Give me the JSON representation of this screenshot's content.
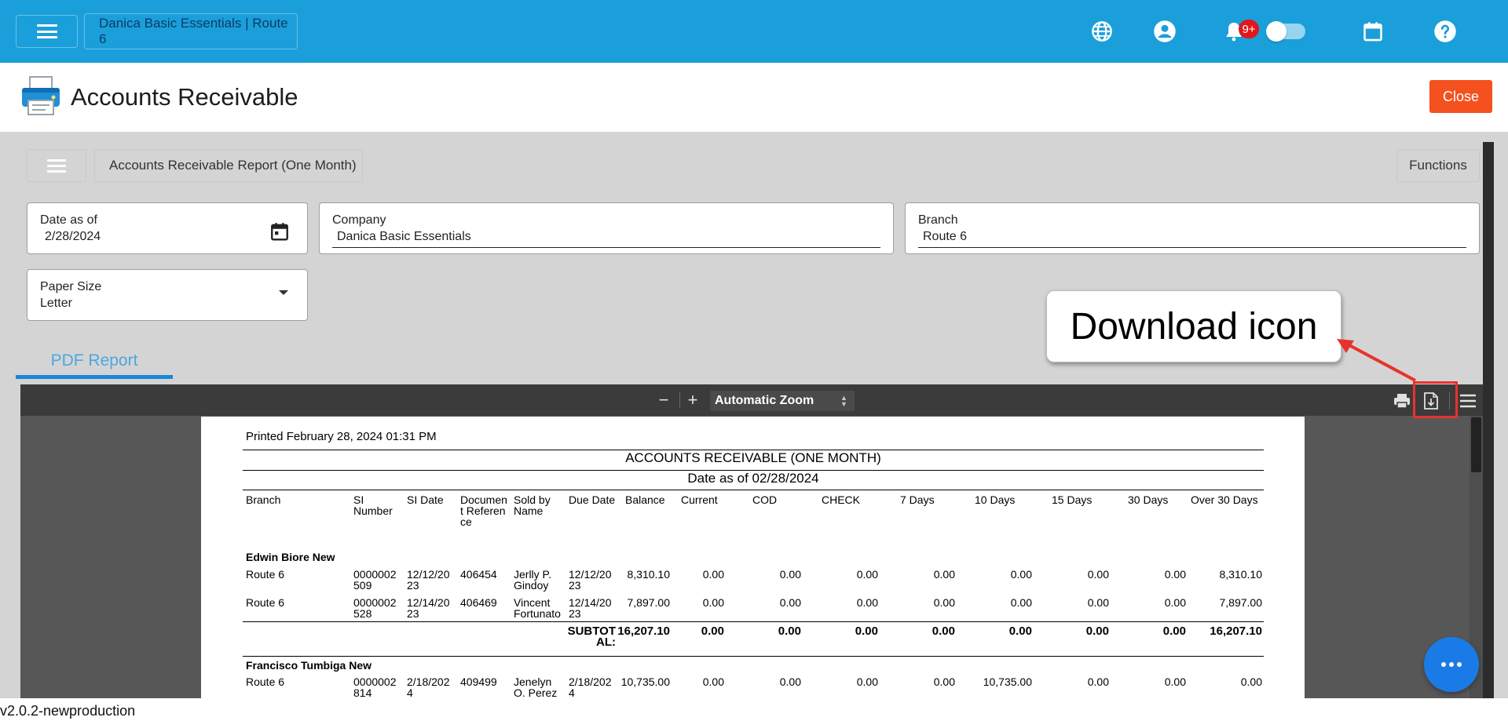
{
  "topbar": {
    "title": "Danica Basic Essentials | Route 6",
    "notification_badge": "9+",
    "accent_color": "#1a9fdb"
  },
  "header": {
    "title": "Accounts Receivable",
    "close_label": "Close"
  },
  "subbar": {
    "report_title": "Accounts Receivable Report (One Month)",
    "functions_label": "Functions"
  },
  "filters": {
    "date_label": "Date as of",
    "date_value": "2/28/2024",
    "company_label": "Company",
    "company_value": "Danica Basic Essentials",
    "branch_label": "Branch",
    "branch_value": "Route 6",
    "paper_label": "Paper Size",
    "paper_value": "Letter"
  },
  "tabs": {
    "pdf_label": "PDF Report"
  },
  "viewer": {
    "zoom_minus": "−",
    "zoom_plus": "+",
    "zoom_value": "Automatic Zoom"
  },
  "report": {
    "printed": "Printed February 28, 2024 01:31 PM",
    "title": "ACCOUNTS RECEIVABLE (ONE MONTH)",
    "date_as_of": "Date as of 02/28/2024",
    "columns": [
      "Branch",
      "SI Number",
      "SI Date",
      "Document Reference",
      "Sold by Name",
      "Due Date",
      "Balance",
      "Current",
      "COD",
      "CHECK",
      "7 Days",
      "10 Days",
      "15 Days",
      "30 Days",
      "Over 30 Days"
    ],
    "groups": [
      {
        "name": "Edwin Biore New",
        "rows": [
          {
            "branch": "Route 6",
            "si_number": "0000002509",
            "si_date": "12/12/2023",
            "doc_ref": "406454",
            "sold_by": "Jerlly P. Gindoy",
            "due_date": "12/12/2023",
            "balance": "8,310.10",
            "current": "0.00",
            "cod": "0.00",
            "check": "0.00",
            "d7": "0.00",
            "d10": "0.00",
            "d15": "0.00",
            "d30": "0.00",
            "over30": "8,310.10"
          },
          {
            "branch": "Route 6",
            "si_number": "0000002528",
            "si_date": "12/14/2023",
            "doc_ref": "406469",
            "sold_by": "Vincent Fortunato",
            "due_date": "12/14/2023",
            "balance": "7,897.00",
            "current": "0.00",
            "cod": "0.00",
            "check": "0.00",
            "d7": "0.00",
            "d10": "0.00",
            "d15": "0.00",
            "d30": "0.00",
            "over30": "7,897.00"
          }
        ],
        "subtotal": {
          "label": "SUBTOTAL:",
          "balance": "16,207.10",
          "current": "0.00",
          "cod": "0.00",
          "check": "0.00",
          "d7": "0.00",
          "d10": "0.00",
          "d15": "0.00",
          "d30": "0.00",
          "over30": "16,207.10"
        }
      },
      {
        "name": "Francisco Tumbiga New",
        "rows": [
          {
            "branch": "Route 6",
            "si_number": "0000002814",
            "si_date": "2/18/2024",
            "doc_ref": "409499",
            "sold_by": "Jenelyn O. Perez",
            "due_date": "2/18/2024",
            "balance": "10,735.00",
            "current": "0.00",
            "cod": "0.00",
            "check": "0.00",
            "d7": "0.00",
            "d10": "10,735.00",
            "d15": "0.00",
            "d30": "0.00",
            "over30": "0.00"
          }
        ]
      }
    ]
  },
  "annotation": {
    "callout_text": "Download icon",
    "color": "#e8322d"
  },
  "footer": {
    "version": "v2.0.2-newproduction"
  }
}
